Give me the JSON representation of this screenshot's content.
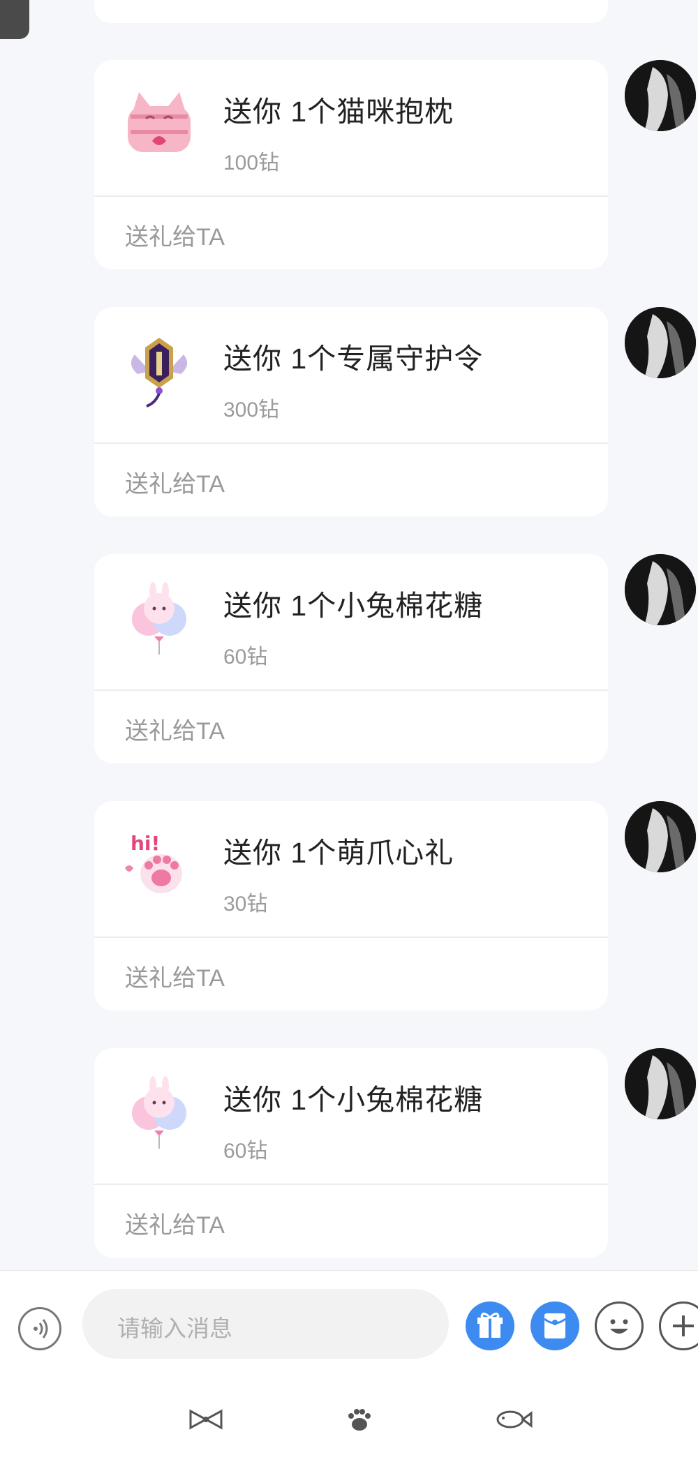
{
  "messages": [
    {
      "gift_image": "pink-cat-pillow",
      "title": "送你 1个猫咪抱枕",
      "price": "100钻",
      "action": "送礼给TA"
    },
    {
      "gift_image": "guardian-medal",
      "title": "送你 1个专属守护令",
      "price": "300钻",
      "action": "送礼给TA"
    },
    {
      "gift_image": "bunny-cotton-candy",
      "title": "送你 1个小兔棉花糖",
      "price": "60钻",
      "action": "送礼给TA"
    },
    {
      "gift_image": "cute-paw-hi",
      "title": "送你 1个萌爪心礼",
      "price": "30钻",
      "action": "送礼给TA"
    },
    {
      "gift_image": "bunny-cotton-candy",
      "title": "送你 1个小兔棉花糖",
      "price": "60钻",
      "action": "送礼给TA"
    }
  ],
  "input": {
    "placeholder": "请输入消息"
  },
  "toolbar": {
    "icons": [
      "voice-icon",
      "gift-icon",
      "red-packet-icon",
      "emoji-icon",
      "plus-icon"
    ]
  },
  "tabs": [
    "bow-icon",
    "paw-icon",
    "fish-icon"
  ],
  "colors": {
    "accent": "#3d8bf0",
    "background": "#f5f7fa",
    "card": "#ffffff"
  }
}
